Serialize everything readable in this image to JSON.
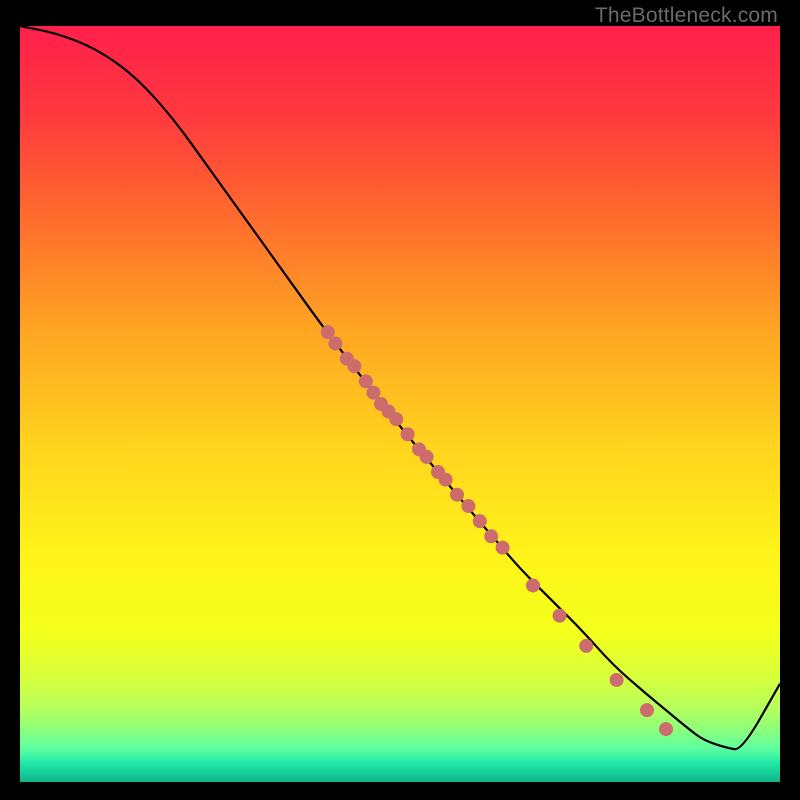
{
  "watermark": "TheBottleneck.com",
  "chart_data": {
    "type": "line",
    "title": "",
    "xlabel": "",
    "ylabel": "",
    "xlim": [
      0,
      100
    ],
    "ylim": [
      0,
      100
    ],
    "grid": false,
    "background_gradient": {
      "stops": [
        {
          "offset": 0.0,
          "color": "#ff1f4b"
        },
        {
          "offset": 0.12,
          "color": "#ff3a3e"
        },
        {
          "offset": 0.25,
          "color": "#ff6a2d"
        },
        {
          "offset": 0.4,
          "color": "#ffa423"
        },
        {
          "offset": 0.55,
          "color": "#ffd21e"
        },
        {
          "offset": 0.7,
          "color": "#fff31a"
        },
        {
          "offset": 0.8,
          "color": "#f3ff1a"
        },
        {
          "offset": 0.86,
          "color": "#d9ff3a"
        },
        {
          "offset": 0.9,
          "color": "#b8ff5a"
        },
        {
          "offset": 0.93,
          "color": "#8fff7a"
        },
        {
          "offset": 0.955,
          "color": "#5effa0"
        },
        {
          "offset": 0.975,
          "color": "#20e8a8"
        },
        {
          "offset": 1.0,
          "color": "#0fb58a"
        }
      ]
    },
    "series": [
      {
        "name": "curve",
        "x": [
          0,
          5,
          10,
          15,
          20,
          25,
          30,
          35,
          40,
          45,
          50,
          55,
          60,
          63,
          66,
          70,
          74,
          78,
          82,
          85,
          88,
          90,
          93,
          95,
          100
        ],
        "y": [
          100,
          99,
          97,
          93.5,
          88,
          81,
          74,
          67,
          60,
          53.5,
          47,
          41,
          35,
          31.5,
          28,
          24,
          20,
          15.5,
          12,
          9.5,
          7,
          5.5,
          4.5,
          4.2,
          13
        ]
      }
    ],
    "markers": {
      "name": "points",
      "x": [
        40.5,
        41.5,
        43.0,
        44.0,
        45.5,
        46.5,
        47.5,
        48.5,
        49.5,
        51.0,
        52.5,
        53.5,
        55.0,
        56.0,
        57.5,
        59.0,
        60.5,
        62.0,
        63.5,
        67.5,
        71.0,
        74.5,
        78.5,
        82.5,
        85.0
      ],
      "y": [
        59.5,
        58.0,
        56.0,
        55.0,
        53.0,
        51.5,
        50.0,
        49.0,
        48.0,
        46.0,
        44.0,
        43.0,
        41.0,
        40.0,
        38.0,
        36.5,
        34.5,
        32.5,
        31.0,
        26.0,
        22.0,
        18.0,
        13.5,
        9.5,
        7.0
      ],
      "color": "#cc6c6c",
      "radius": 7
    }
  }
}
